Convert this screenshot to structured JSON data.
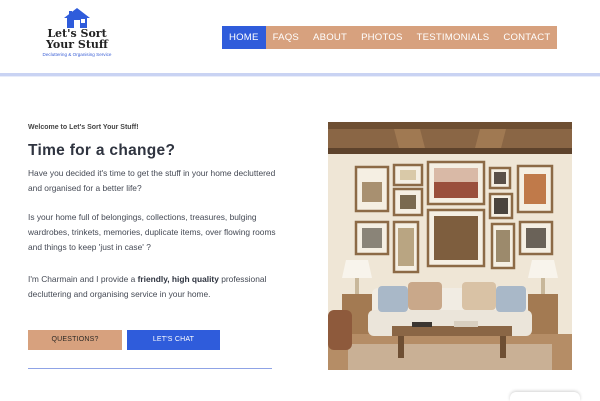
{
  "logo": {
    "line1": "Let's Sort",
    "line2": "Your Stuff",
    "tagline": "Decluttering & Organising Service",
    "icon": "house-icon",
    "color": "#2f5cdb"
  },
  "nav": {
    "items": [
      "HOME",
      "FAQS",
      "ABOUT",
      "PHOTOS",
      "TESTIMONIALS",
      "CONTACT"
    ],
    "active": "HOME"
  },
  "main": {
    "sub_header": "Welcome to Let's Sort Your Stuff!",
    "headline": "Time for a change?",
    "para1": "Have you decided it's time to get the stuff in your home decluttered and organised for a better life?",
    "para2": "Is your home full of belongings, collections, treasures, bulging wardrobes, trinkets, memories, duplicate items, over flowing rooms  and things to keep 'just in case' ?",
    "para3_before": "I'm Charmain and I provide a ",
    "para3_bold": "friendly, high quality",
    "para3_after": " professional decluttering and organising service in your home."
  },
  "buttons": {
    "questions": "QUESTIONS?",
    "chat": "LET'S CHAT"
  },
  "colors": {
    "accent_blue": "#2f5cdb",
    "accent_tan": "#d7a17e"
  }
}
